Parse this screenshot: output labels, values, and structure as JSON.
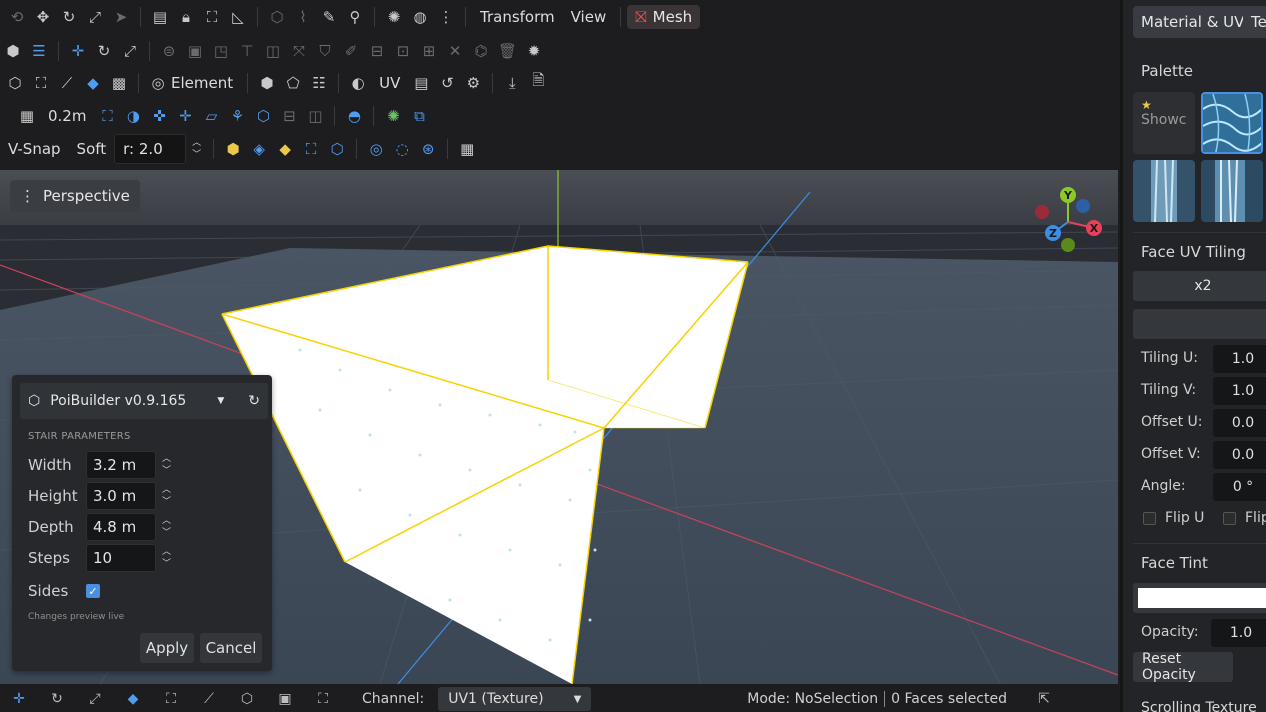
{
  "toolbar": {
    "transform_label": "Transform",
    "view_label": "View",
    "mesh_label": "Mesh",
    "element_label": "Element",
    "uv_label": "UV",
    "grid_size": "0.2m",
    "vsnap_label": "V-Snap",
    "soft_label": "Soft",
    "radius_value": "r: 2.0"
  },
  "viewport": {
    "view_mode": "Perspective",
    "axes": {
      "x": "X",
      "y": "Y",
      "z": "Z"
    },
    "colors": {
      "x_axis": "#e8405a",
      "y_axis": "#8ac926",
      "z_axis": "#3b8ee8",
      "selection": "#f5d300"
    }
  },
  "poi_panel": {
    "title": "PoiBuilder v0.9.165",
    "section": "STAIR PARAMETERS",
    "width_label": "Width",
    "width_value": "3.2 m",
    "height_label": "Height",
    "height_value": "3.0 m",
    "depth_label": "Depth",
    "depth_value": "4.8 m",
    "steps_label": "Steps",
    "steps_value": "10",
    "sides_label": "Sides",
    "sides_checked": true,
    "note": "Changes preview live",
    "apply_label": "Apply",
    "cancel_label": "Cancel"
  },
  "right_panel": {
    "tab_material": "Material & UV",
    "tab_second": "Te",
    "palette_title": "Palette",
    "showcase_label": "Showc",
    "face_uv_tiling_title": "Face UV Tiling",
    "x2_label": "x2",
    "tiling_u_label": "Tiling U:",
    "tiling_u_value": "1.0",
    "tiling_v_label": "Tiling V:",
    "tiling_v_value": "1.0",
    "offset_u_label": "Offset U:",
    "offset_u_value": "0.0",
    "offset_v_label": "Offset V:",
    "offset_v_value": "0.0",
    "angle_label": "Angle:",
    "angle_value": "0 °",
    "flip_u_label": "Flip U",
    "flip_v_label": "Flip",
    "face_tint_title": "Face Tint",
    "opacity_label": "Opacity:",
    "opacity_value": "1.0",
    "reset_opacity_label": "Reset Opacity",
    "cut_off_label": "Scrolling Texture"
  },
  "bottom_bar": {
    "channel_label": "Channel:",
    "channel_value": "UV1 (Texture)",
    "mode_text": "Mode: NoSelection",
    "faces_text": "0 Faces selected"
  }
}
